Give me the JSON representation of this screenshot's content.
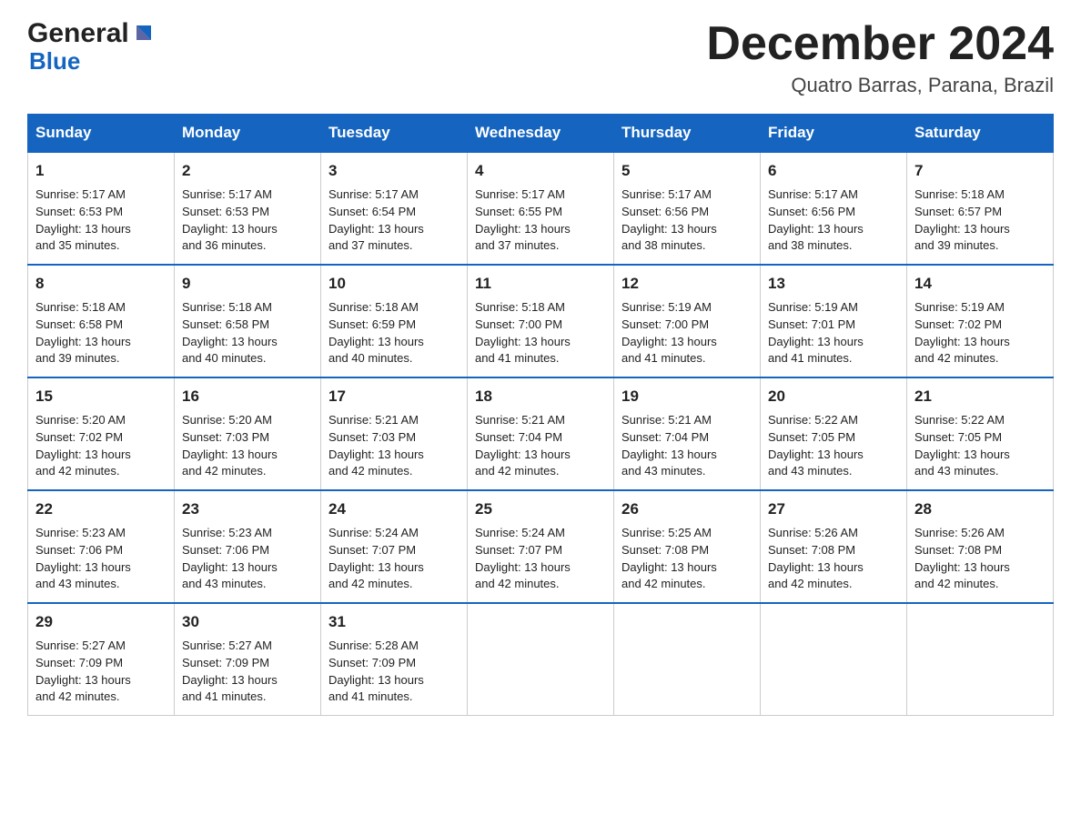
{
  "header": {
    "logo_general": "General",
    "logo_blue": "Blue",
    "month_title": "December 2024",
    "location": "Quatro Barras, Parana, Brazil"
  },
  "days_of_week": [
    "Sunday",
    "Monday",
    "Tuesday",
    "Wednesday",
    "Thursday",
    "Friday",
    "Saturday"
  ],
  "weeks": [
    [
      {
        "day": "1",
        "sunrise": "5:17 AM",
        "sunset": "6:53 PM",
        "daylight": "13 hours and 35 minutes."
      },
      {
        "day": "2",
        "sunrise": "5:17 AM",
        "sunset": "6:53 PM",
        "daylight": "13 hours and 36 minutes."
      },
      {
        "day": "3",
        "sunrise": "5:17 AM",
        "sunset": "6:54 PM",
        "daylight": "13 hours and 37 minutes."
      },
      {
        "day": "4",
        "sunrise": "5:17 AM",
        "sunset": "6:55 PM",
        "daylight": "13 hours and 37 minutes."
      },
      {
        "day": "5",
        "sunrise": "5:17 AM",
        "sunset": "6:56 PM",
        "daylight": "13 hours and 38 minutes."
      },
      {
        "day": "6",
        "sunrise": "5:17 AM",
        "sunset": "6:56 PM",
        "daylight": "13 hours and 38 minutes."
      },
      {
        "day": "7",
        "sunrise": "5:18 AM",
        "sunset": "6:57 PM",
        "daylight": "13 hours and 39 minutes."
      }
    ],
    [
      {
        "day": "8",
        "sunrise": "5:18 AM",
        "sunset": "6:58 PM",
        "daylight": "13 hours and 39 minutes."
      },
      {
        "day": "9",
        "sunrise": "5:18 AM",
        "sunset": "6:58 PM",
        "daylight": "13 hours and 40 minutes."
      },
      {
        "day": "10",
        "sunrise": "5:18 AM",
        "sunset": "6:59 PM",
        "daylight": "13 hours and 40 minutes."
      },
      {
        "day": "11",
        "sunrise": "5:18 AM",
        "sunset": "7:00 PM",
        "daylight": "13 hours and 41 minutes."
      },
      {
        "day": "12",
        "sunrise": "5:19 AM",
        "sunset": "7:00 PM",
        "daylight": "13 hours and 41 minutes."
      },
      {
        "day": "13",
        "sunrise": "5:19 AM",
        "sunset": "7:01 PM",
        "daylight": "13 hours and 41 minutes."
      },
      {
        "day": "14",
        "sunrise": "5:19 AM",
        "sunset": "7:02 PM",
        "daylight": "13 hours and 42 minutes."
      }
    ],
    [
      {
        "day": "15",
        "sunrise": "5:20 AM",
        "sunset": "7:02 PM",
        "daylight": "13 hours and 42 minutes."
      },
      {
        "day": "16",
        "sunrise": "5:20 AM",
        "sunset": "7:03 PM",
        "daylight": "13 hours and 42 minutes."
      },
      {
        "day": "17",
        "sunrise": "5:21 AM",
        "sunset": "7:03 PM",
        "daylight": "13 hours and 42 minutes."
      },
      {
        "day": "18",
        "sunrise": "5:21 AM",
        "sunset": "7:04 PM",
        "daylight": "13 hours and 42 minutes."
      },
      {
        "day": "19",
        "sunrise": "5:21 AM",
        "sunset": "7:04 PM",
        "daylight": "13 hours and 43 minutes."
      },
      {
        "day": "20",
        "sunrise": "5:22 AM",
        "sunset": "7:05 PM",
        "daylight": "13 hours and 43 minutes."
      },
      {
        "day": "21",
        "sunrise": "5:22 AM",
        "sunset": "7:05 PM",
        "daylight": "13 hours and 43 minutes."
      }
    ],
    [
      {
        "day": "22",
        "sunrise": "5:23 AM",
        "sunset": "7:06 PM",
        "daylight": "13 hours and 43 minutes."
      },
      {
        "day": "23",
        "sunrise": "5:23 AM",
        "sunset": "7:06 PM",
        "daylight": "13 hours and 43 minutes."
      },
      {
        "day": "24",
        "sunrise": "5:24 AM",
        "sunset": "7:07 PM",
        "daylight": "13 hours and 42 minutes."
      },
      {
        "day": "25",
        "sunrise": "5:24 AM",
        "sunset": "7:07 PM",
        "daylight": "13 hours and 42 minutes."
      },
      {
        "day": "26",
        "sunrise": "5:25 AM",
        "sunset": "7:08 PM",
        "daylight": "13 hours and 42 minutes."
      },
      {
        "day": "27",
        "sunrise": "5:26 AM",
        "sunset": "7:08 PM",
        "daylight": "13 hours and 42 minutes."
      },
      {
        "day": "28",
        "sunrise": "5:26 AM",
        "sunset": "7:08 PM",
        "daylight": "13 hours and 42 minutes."
      }
    ],
    [
      {
        "day": "29",
        "sunrise": "5:27 AM",
        "sunset": "7:09 PM",
        "daylight": "13 hours and 42 minutes."
      },
      {
        "day": "30",
        "sunrise": "5:27 AM",
        "sunset": "7:09 PM",
        "daylight": "13 hours and 41 minutes."
      },
      {
        "day": "31",
        "sunrise": "5:28 AM",
        "sunset": "7:09 PM",
        "daylight": "13 hours and 41 minutes."
      },
      null,
      null,
      null,
      null
    ]
  ],
  "labels": {
    "sunrise": "Sunrise:",
    "sunset": "Sunset:",
    "daylight": "Daylight:"
  }
}
